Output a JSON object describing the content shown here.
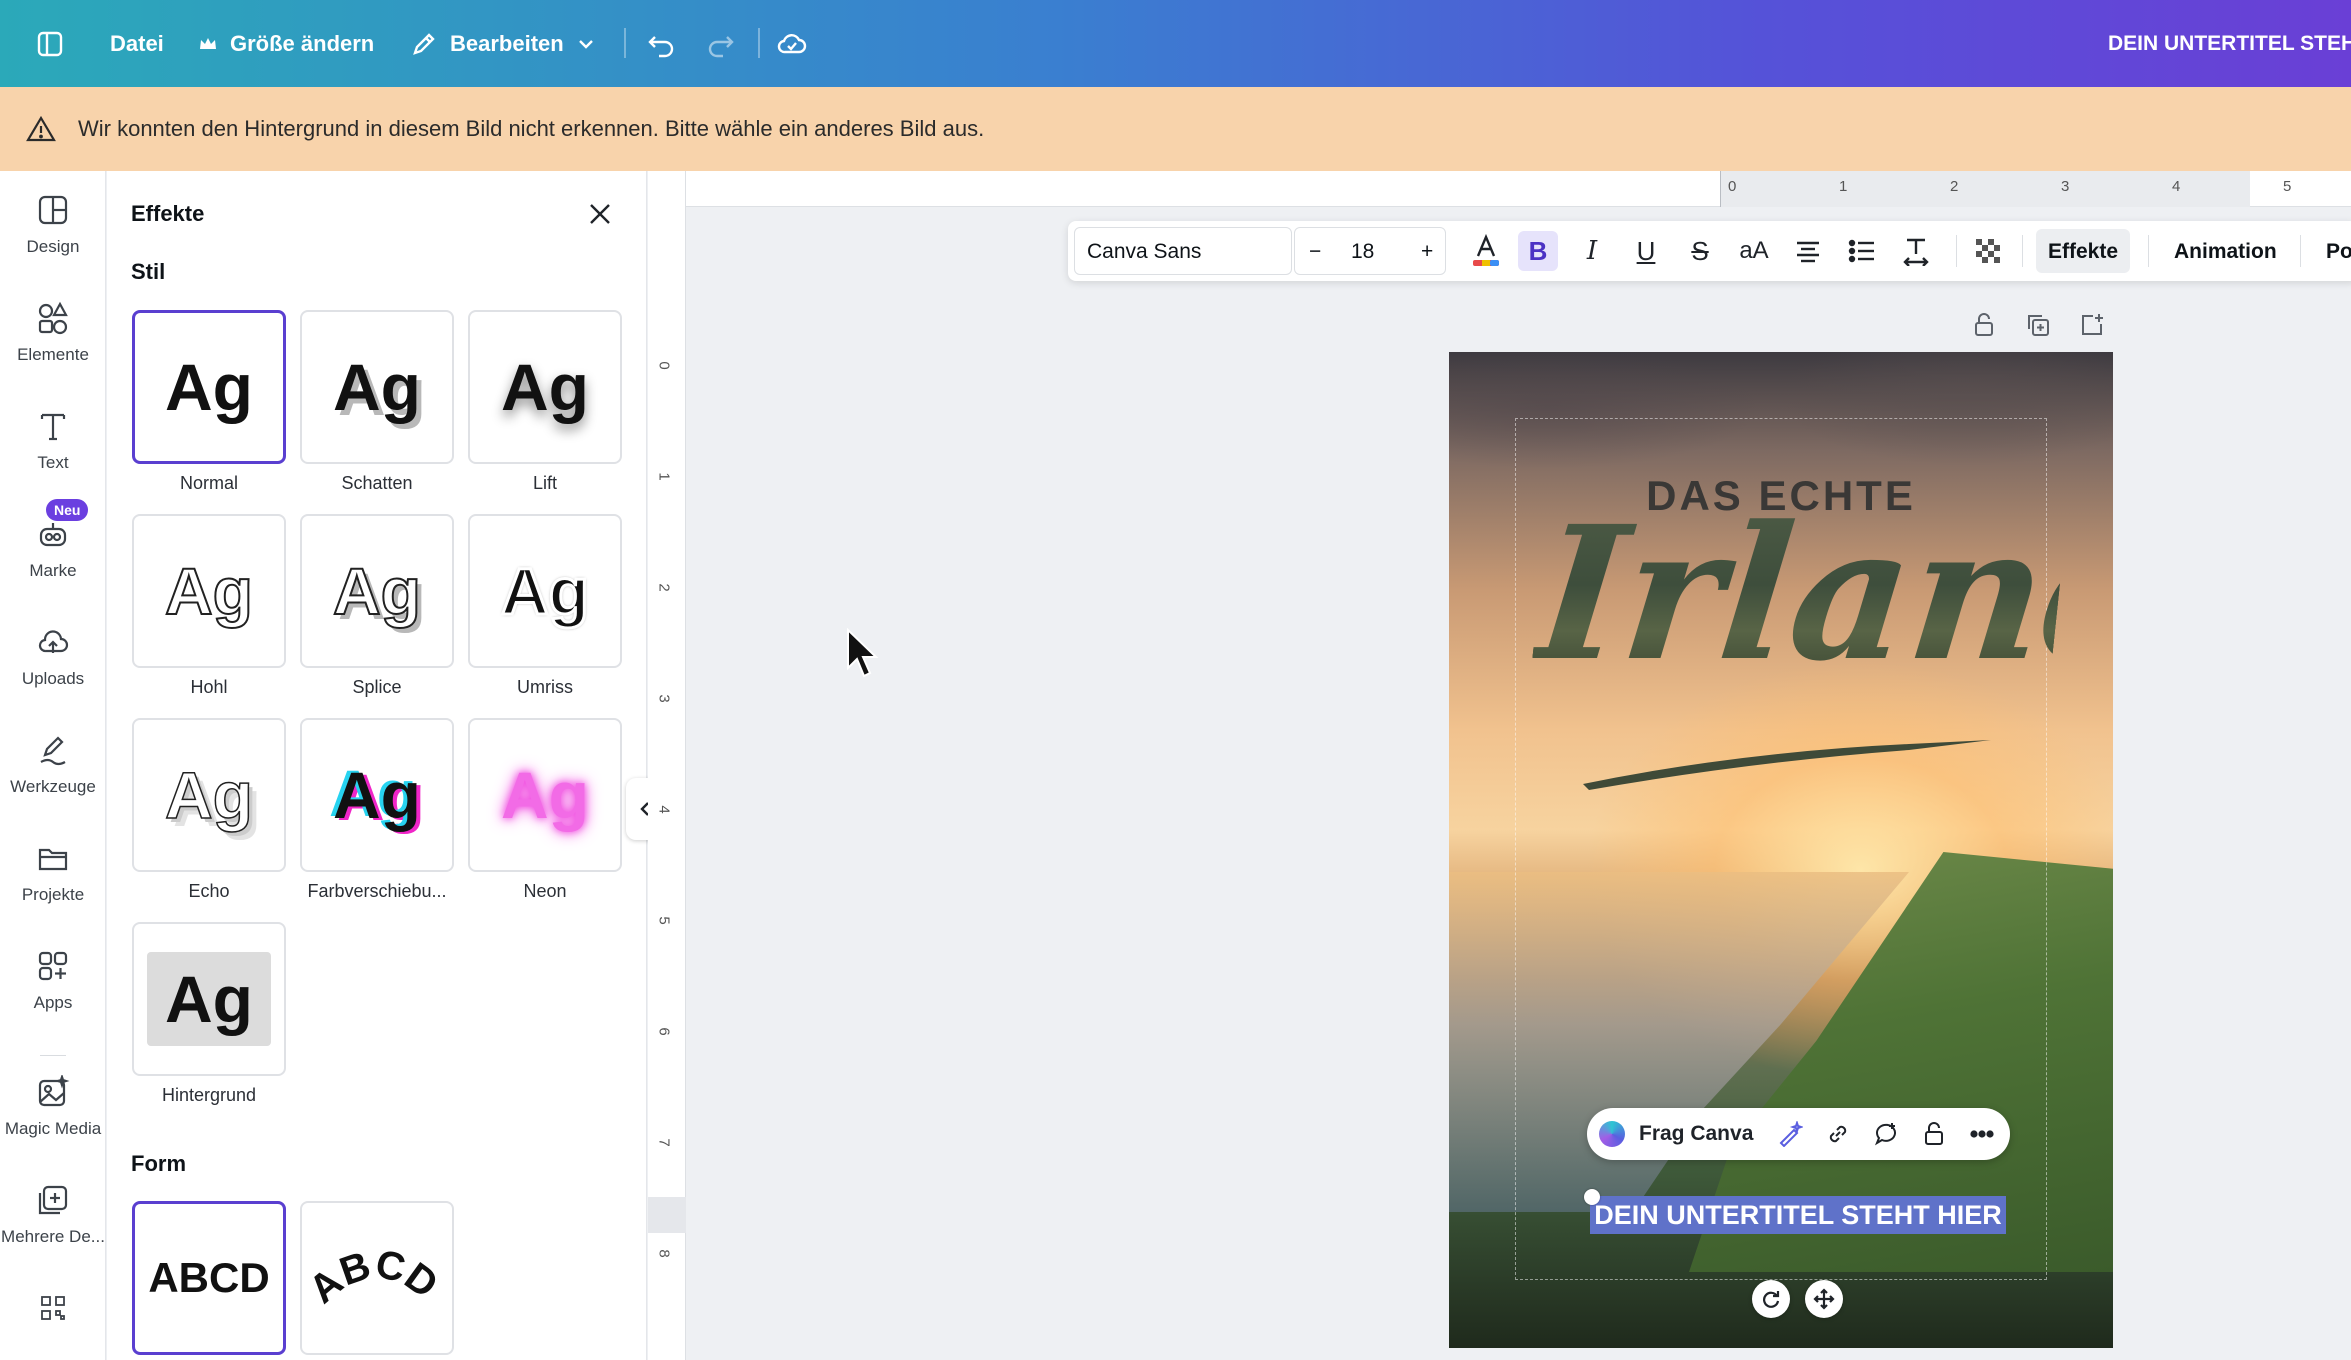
{
  "topbar": {
    "file": "Datei",
    "resize": "Größe ändern",
    "edit": "Bearbeiten",
    "doc_title": "DEIN UNTERTITEL STEH"
  },
  "warning": {
    "text": "Wir konnten den Hintergrund in diesem Bild nicht erkennen. Bitte wähle ein anderes Bild aus."
  },
  "rail": {
    "items": [
      {
        "label": "Design",
        "icon": "design-icon"
      },
      {
        "label": "Elemente",
        "icon": "elements-icon"
      },
      {
        "label": "Text",
        "icon": "text-icon"
      },
      {
        "label": "Marke",
        "icon": "brand-icon",
        "badge": "Neu"
      },
      {
        "label": "Uploads",
        "icon": "upload-cloud-icon"
      },
      {
        "label": "Werkzeuge",
        "icon": "draw-tools-icon"
      },
      {
        "label": "Projekte",
        "icon": "folder-icon"
      },
      {
        "label": "Apps",
        "icon": "apps-icon"
      },
      {
        "label": "Magic Media",
        "icon": "magic-media-icon"
      },
      {
        "label": "Mehrere De...",
        "icon": "multiple-designs-icon"
      }
    ]
  },
  "panel": {
    "title": "Effekte",
    "style_section": "Stil",
    "styles": [
      "Normal",
      "Schatten",
      "Lift",
      "Hohl",
      "Splice",
      "Umriss",
      "Echo",
      "Farbverschiebu...",
      "Neon",
      "Hintergrund"
    ],
    "sample": "Ag",
    "shape_section": "Form",
    "shape_sample": "ABCD"
  },
  "rulers": {
    "horizontal": [
      "0",
      "1",
      "2",
      "3",
      "4",
      "5"
    ],
    "vertical": [
      "0",
      "1",
      "2",
      "3",
      "4",
      "5",
      "6",
      "7",
      "8"
    ]
  },
  "text_toolbar": {
    "font": "Canva Sans",
    "size": "18",
    "minus": "−",
    "plus": "+",
    "effects": "Effekte",
    "animation": "Animation",
    "position": "Po"
  },
  "design": {
    "kicker": "DAS ECHTE",
    "headline": "Irland",
    "subtitle": "DEIN UNTERTITEL STEHT HIER",
    "ask_label": "Frag Canva"
  },
  "colors": {
    "accent": "#6b3fe0",
    "selection": "#5a3fd0",
    "warning_bg": "#f8d3ab"
  }
}
